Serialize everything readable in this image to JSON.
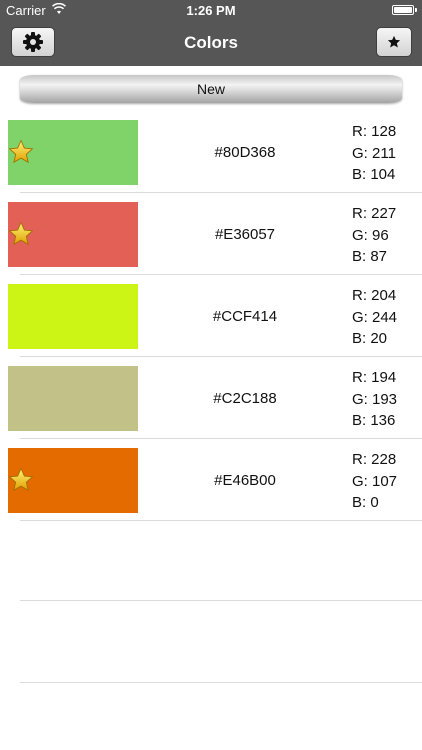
{
  "status_bar": {
    "carrier": "Carrier",
    "time": "1:26 PM"
  },
  "nav": {
    "title": "Colors",
    "left_icon": "gear-icon",
    "right_icon": "star-icon"
  },
  "new_button": {
    "label": "New"
  },
  "colors": [
    {
      "hex": "#80D368",
      "color": "#80D368",
      "r": "R: 128",
      "g": "G: 211",
      "b": "B: 104",
      "favorite": true
    },
    {
      "hex": "#E36057",
      "color": "#E36057",
      "r": "R: 227",
      "g": "G: 96",
      "b": "B: 87",
      "favorite": true
    },
    {
      "hex": "#CCF414",
      "color": "#CCF414",
      "r": "R: 204",
      "g": "G: 244",
      "b": "B: 20",
      "favorite": false
    },
    {
      "hex": "#C2C188",
      "color": "#C2C188",
      "r": "R: 194",
      "g": "G: 193",
      "b": "B: 136",
      "favorite": false
    },
    {
      "hex": "#E46B00",
      "color": "#E46B00",
      "r": "R: 228",
      "g": "G: 107",
      "b": "B: 0",
      "favorite": true
    }
  ]
}
